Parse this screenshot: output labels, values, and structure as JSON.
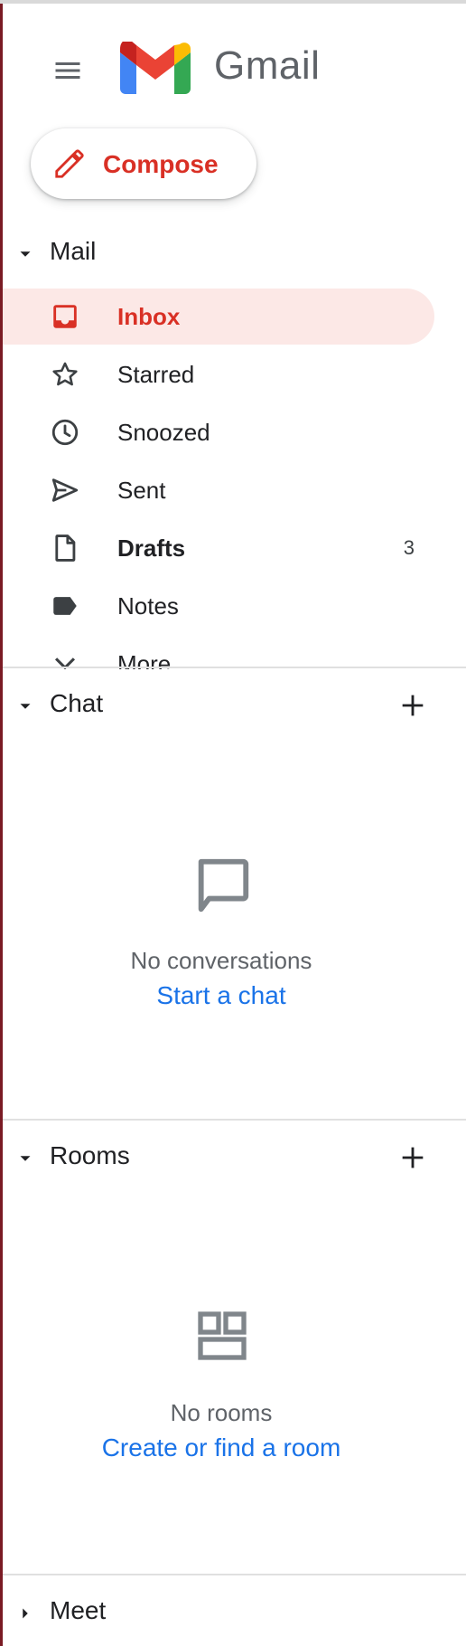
{
  "app": {
    "title": "Gmail"
  },
  "compose": {
    "label": "Compose"
  },
  "mail_section": {
    "title": "Mail"
  },
  "nav": {
    "items": [
      {
        "label": "Inbox",
        "icon": "inbox-icon",
        "active": true,
        "count": ""
      },
      {
        "label": "Starred",
        "icon": "star-icon",
        "active": false,
        "count": ""
      },
      {
        "label": "Snoozed",
        "icon": "clock-icon",
        "active": false,
        "count": ""
      },
      {
        "label": "Sent",
        "icon": "send-icon",
        "active": false,
        "count": ""
      },
      {
        "label": "Drafts",
        "icon": "draft-icon",
        "active": false,
        "count": "3"
      },
      {
        "label": "Notes",
        "icon": "label-icon",
        "active": false,
        "count": ""
      },
      {
        "label": "More",
        "icon": "chevron-down-icon",
        "active": false,
        "count": ""
      }
    ]
  },
  "chat": {
    "title": "Chat",
    "empty_text": "No conversations",
    "link": "Start a chat"
  },
  "rooms": {
    "title": "Rooms",
    "empty_text": "No rooms",
    "link": "Create or find a room"
  },
  "meet": {
    "title": "Meet"
  },
  "colors": {
    "accent_red": "#d93025",
    "active_bg": "#fce8e6",
    "link_blue": "#1a73e8",
    "icon_gray": "#5f6368"
  }
}
